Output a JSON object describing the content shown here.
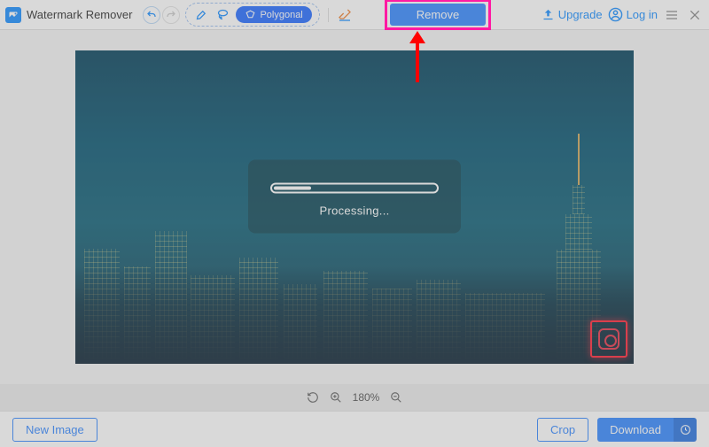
{
  "app": {
    "title": "Watermark Remover"
  },
  "toolbar": {
    "polygonal_label": "Polygonal",
    "remove_label": "Remove",
    "upgrade_label": "Upgrade",
    "login_label": "Log in"
  },
  "processing": {
    "label": "Processing..."
  },
  "zoom": {
    "value": "180%"
  },
  "bottom": {
    "new_image": "New Image",
    "crop": "Crop",
    "download": "Download"
  },
  "colors": {
    "accent": "#3a8bff",
    "highlight": "#ff1aa3",
    "arrow": "#ff0000"
  }
}
